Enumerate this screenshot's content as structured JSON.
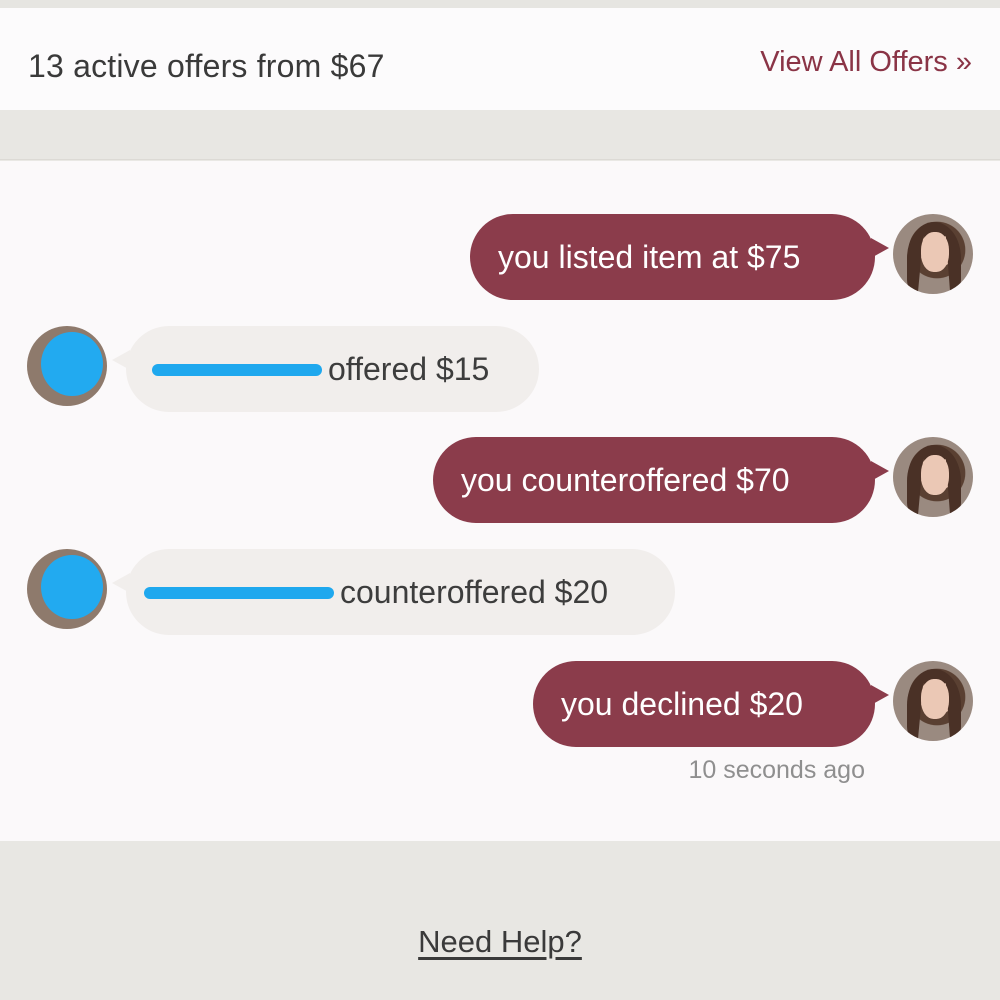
{
  "offers": {
    "summary": "13 active offers from $67",
    "view_all_label": "View All Offers »"
  },
  "thread": {
    "messages": [
      {
        "sender": "me",
        "text": "you listed item at $75"
      },
      {
        "sender": "buyer",
        "text": "offered $15"
      },
      {
        "sender": "me",
        "text": "you counteroffered $70"
      },
      {
        "sender": "buyer",
        "text": "counteroffered $20"
      },
      {
        "sender": "me",
        "text": "you declined $20"
      }
    ],
    "last_timestamp": "10 seconds ago"
  },
  "footer": {
    "help_label": "Need Help?"
  },
  "colors": {
    "accent": "#8b3c4b",
    "redaction": "#1fa8ee",
    "incoming_bubble": "#f1eeec"
  }
}
